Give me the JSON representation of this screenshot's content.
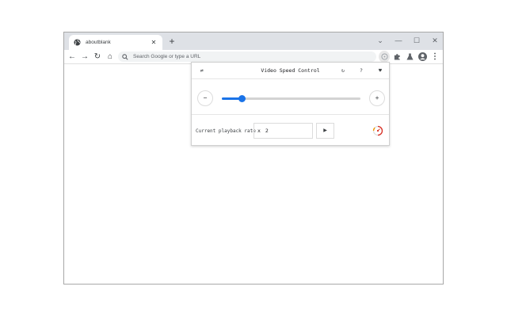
{
  "tab": {
    "title": "aboutblank",
    "close": "✕"
  },
  "newtab": "+",
  "window_controls": {
    "dropdown": "⌄",
    "minimize": "—",
    "maximize": "☐",
    "close": "✕"
  },
  "nav": {
    "back": "←",
    "forward": "→",
    "reload": "↻",
    "home": "⌂"
  },
  "omnibox": {
    "placeholder": "Search Google or type a URL"
  },
  "toolbar_icons": [
    "video-speed-extension-icon",
    "puzzle-extensions-icon",
    "flask-labs-icon",
    "profile-avatar-icon",
    "kebab-menu-icon"
  ],
  "kebab": "⋮",
  "popup": {
    "settings_icon": "⇄",
    "title": "Video Speed Control",
    "reset_icon": "↻",
    "help_icon": "?",
    "heart_icon": "♥",
    "decrease": "−",
    "increase": "+",
    "slider": {
      "value_fraction": 0.14
    },
    "rate_label": "Current playback rate",
    "rate_prefix": "x",
    "rate_value": "2",
    "play_icon": "▶",
    "accent": "#1a73e8"
  }
}
